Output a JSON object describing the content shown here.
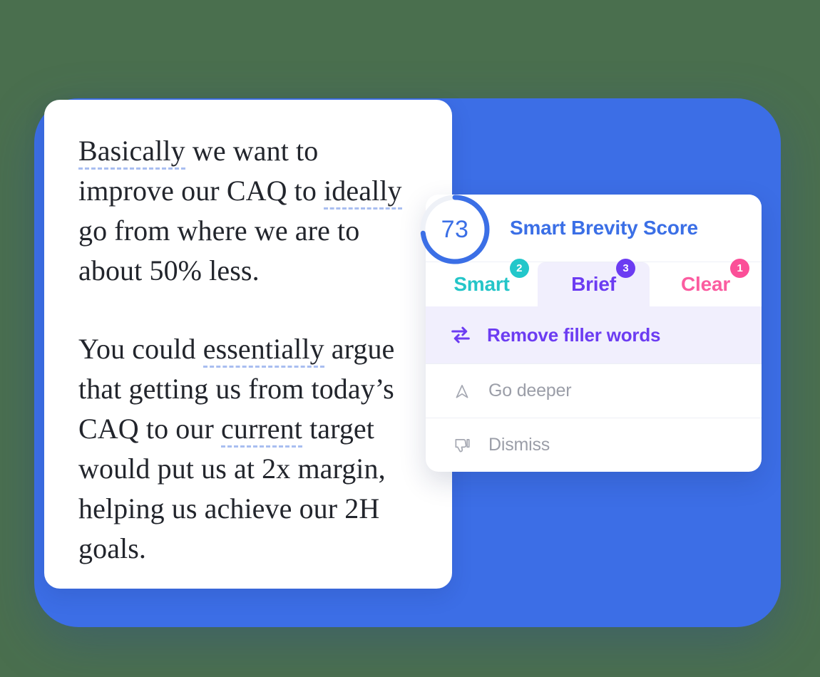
{
  "theme": {
    "backdrop_blue": "#3c6ee6",
    "brand_blue": "#3b6fe6",
    "smart_teal": "#24c5c8",
    "brief_purple": "#6c3cf2",
    "clear_pink": "#fb5ca0",
    "selected_tab_bg": "#f1effd",
    "suggestion_underline": "#a9bef0"
  },
  "document": {
    "paragraphs": [
      {
        "runs": [
          {
            "text": "Basically",
            "suggested": true
          },
          {
            "text": " we want to improve our CAQ to ",
            "suggested": false
          },
          {
            "text": "ideally",
            "suggested": true
          },
          {
            "text": " go from where we are to about 50% less.",
            "suggested": false
          }
        ]
      },
      {
        "runs": [
          {
            "text": "You could ",
            "suggested": false
          },
          {
            "text": "essentially",
            "suggested": true
          },
          {
            "text": " argue that getting us from today’s CAQ to our ",
            "suggested": false
          },
          {
            "text": "current",
            "suggested": true
          },
          {
            "text": " target would put us at 2x margin, helping us achieve our 2H goals.",
            "suggested": false
          }
        ]
      }
    ]
  },
  "panel": {
    "score": {
      "value": "73",
      "percent": 73,
      "title": "Smart Brevity Score"
    },
    "tabs": [
      {
        "label": "Smart",
        "badge": "2",
        "selected": false,
        "icon": "tab-smart"
      },
      {
        "label": "Brief",
        "badge": "3",
        "selected": true,
        "icon": "tab-brief"
      },
      {
        "label": "Clear",
        "badge": "1",
        "selected": false,
        "icon": "tab-clear"
      }
    ],
    "actions": [
      {
        "label": "Remove filler words",
        "icon": "swap-arrows-icon",
        "style": "primary"
      },
      {
        "label": "Go deeper",
        "icon": "chevron-up-outline-icon",
        "style": "muted"
      },
      {
        "label": "Dismiss",
        "icon": "thumbs-down-icon",
        "style": "muted"
      }
    ]
  }
}
